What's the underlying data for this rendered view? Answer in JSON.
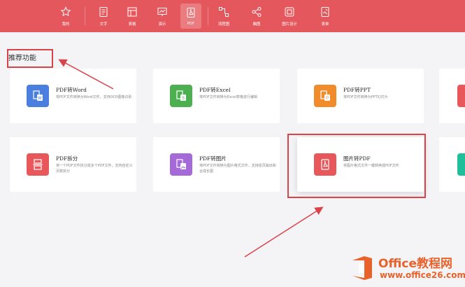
{
  "toolbar": {
    "items": [
      {
        "label": "我的",
        "icon": "star-icon"
      },
      {
        "label": "文字",
        "icon": "document-icon"
      },
      {
        "label": "表格",
        "icon": "table-icon"
      },
      {
        "label": "演示",
        "icon": "presentation-icon"
      },
      {
        "label": "PDF",
        "icon": "pdf-icon",
        "active": true
      },
      {
        "label": "流程图",
        "icon": "flowchart-icon"
      },
      {
        "label": "脑图",
        "icon": "mindmap-icon"
      },
      {
        "label": "图片设计",
        "icon": "image-design-icon"
      },
      {
        "label": "表单",
        "icon": "form-icon"
      }
    ],
    "background": "#e4585d"
  },
  "section": {
    "title": "推荐功能"
  },
  "cards": [
    {
      "title": "PDF转Word",
      "desc": "将PDF文件转换为Word文件，支持OCR图像识别",
      "color": "#4a7fe0",
      "icon": "pdf-to-word-icon"
    },
    {
      "title": "PDF转Excel",
      "desc": "将PDF文件转换为Excel表格进行编辑",
      "color": "#4cb050",
      "icon": "pdf-to-excel-icon"
    },
    {
      "title": "PDF转PPT",
      "desc": "将PDF文件转换为PPT幻灯片",
      "color": "#f08c2c",
      "icon": "pdf-to-ppt-icon"
    },
    {
      "title": "PDF拆分",
      "desc": "将一个PDF文件拆分成多个PDF文件，支持自定义页数拆分",
      "color": "#e8585b",
      "icon": "pdf-split-icon"
    },
    {
      "title": "PDF转图片",
      "desc": "将PDF文件转换为图片格式文件，支持逐页输出和合成长图",
      "color": "#a66ad8",
      "icon": "pdf-to-image-icon"
    },
    {
      "title": "图片转PDF",
      "desc": "将图片格式文件一键转换成PDF文件",
      "color": "#e8585b",
      "icon": "image-to-pdf-icon"
    }
  ],
  "partial_cards": [
    {
      "color": "#e8585b"
    },
    {
      "color": "#1fbf9c"
    }
  ],
  "annotation_color": "#d9434a",
  "watermark": {
    "title": "Office教程网",
    "subtitle": "www.office26.com",
    "color": "#e8632b"
  }
}
